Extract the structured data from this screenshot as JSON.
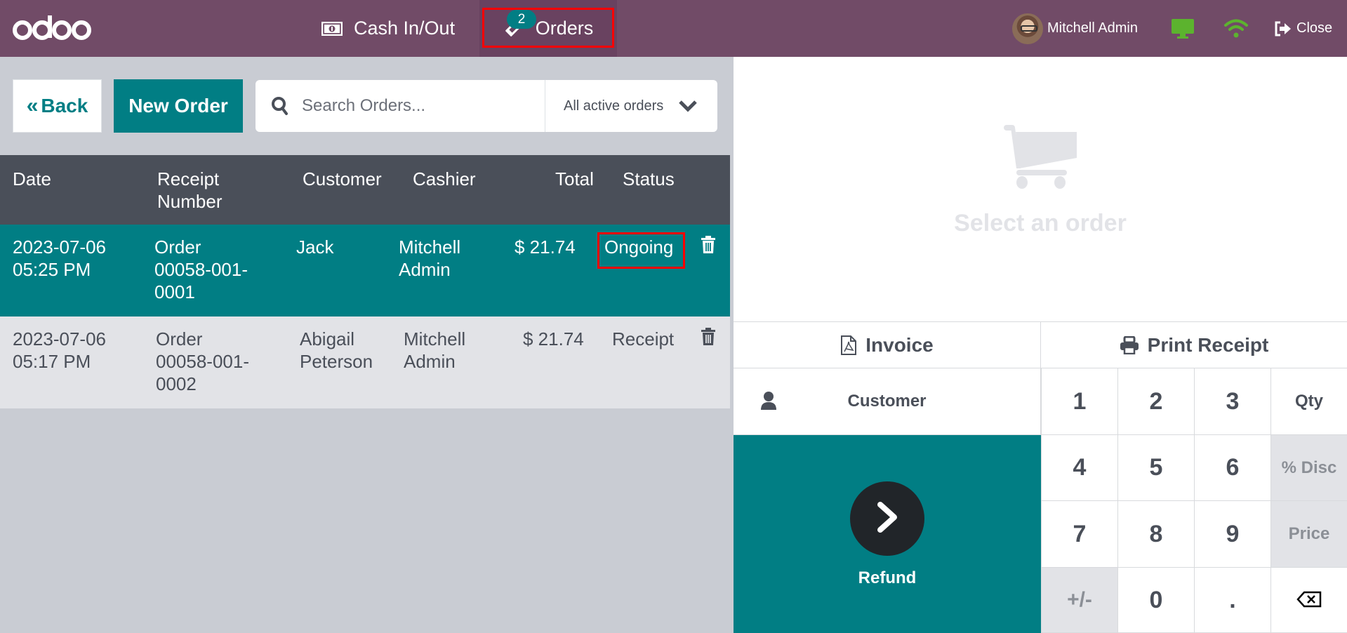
{
  "topbar": {
    "logo": "odoo",
    "nav": {
      "cash_in_out": "Cash In/Out",
      "orders": "Orders",
      "orders_badge": "2"
    },
    "user_name": "Mitchell Admin",
    "close_label": "Close",
    "status_colors": {
      "screen": "#5cb32e",
      "wifi": "#5cb32e"
    }
  },
  "toolbar": {
    "back_label": "Back",
    "new_order_label": "New Order",
    "search_placeholder": "Search Orders...",
    "filter_selected": "All active orders"
  },
  "orders_table": {
    "columns": [
      "Date",
      "Receipt Number",
      "Customer",
      "Cashier",
      "Total",
      "Status"
    ],
    "header_lines": {
      "receipt_line1": "Receipt",
      "receipt_line2": "Number"
    },
    "rows": [
      {
        "date": "2023-07-06",
        "time": "05:25 PM",
        "receipt_l1": "Order",
        "receipt_l2": "00058-001-",
        "receipt_l3": "0001",
        "customer_l1": "Jack",
        "customer_l2": "",
        "cashier_l1": "Mitchell",
        "cashier_l2": "Admin",
        "total": "$ 21.74",
        "status": "Ongoing",
        "selected": true
      },
      {
        "date": "2023-07-06",
        "time": "05:17 PM",
        "receipt_l1": "Order",
        "receipt_l2": "00058-001-",
        "receipt_l3": "0002",
        "customer_l1": "Abigail",
        "customer_l2": "Peterson",
        "cashier_l1": "Mitchell",
        "cashier_l2": "Admin",
        "total": "$ 21.74",
        "status": "Receipt",
        "selected": false
      }
    ]
  },
  "order_detail": {
    "empty_message": "Select an order"
  },
  "actions": {
    "invoice_label": "Invoice",
    "print_receipt_label": "Print Receipt",
    "customer_label": "Customer",
    "refund_label": "Refund"
  },
  "numpad": {
    "keys": [
      "1",
      "2",
      "3",
      "Qty",
      "4",
      "5",
      "6",
      "% Disc",
      "7",
      "8",
      "9",
      "Price",
      "+/-",
      "0",
      ".",
      "backspace"
    ]
  },
  "colors": {
    "brand_purple": "#714b67",
    "accent_teal": "#017e84",
    "table_header": "#4a4f59",
    "highlight_red": "#ff0000"
  }
}
